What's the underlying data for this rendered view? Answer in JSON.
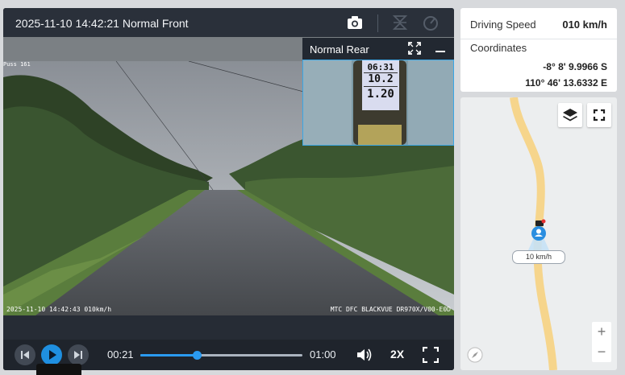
{
  "player": {
    "title": "2025-11-10 14:42:21 Normal Front",
    "overlay_top": "Puss 161",
    "overlay_bottom_left": "2025-11-10 14:42:43 010km/h",
    "overlay_bottom_right": "MTC DFC BLACKVUE DR970X/V00-E0D",
    "pip": {
      "title": "Normal Rear",
      "gauge_lines": [
        "06:31",
        "10.2",
        "1.20"
      ],
      "gauge_units": [
        "",
        "c",
        "m"
      ]
    },
    "controls": {
      "current_time": "00:21",
      "end_time": "01:00",
      "progress": 0.35,
      "playback_rate": "2X"
    }
  },
  "info": {
    "driving_speed_label": "Driving Speed",
    "driving_speed_value": "010 km/h",
    "coordinates_label": "Coordinates",
    "latitude": "-8° 8' 9.9966 S",
    "longitude": "110° 46' 13.6332 E"
  },
  "map": {
    "marker_speed": "10 km/h",
    "zoom_in": "+",
    "zoom_out": "−"
  },
  "colors": {
    "accent": "#1f8fe0",
    "road": "#f6d58c",
    "player_bg": "#262c35"
  }
}
